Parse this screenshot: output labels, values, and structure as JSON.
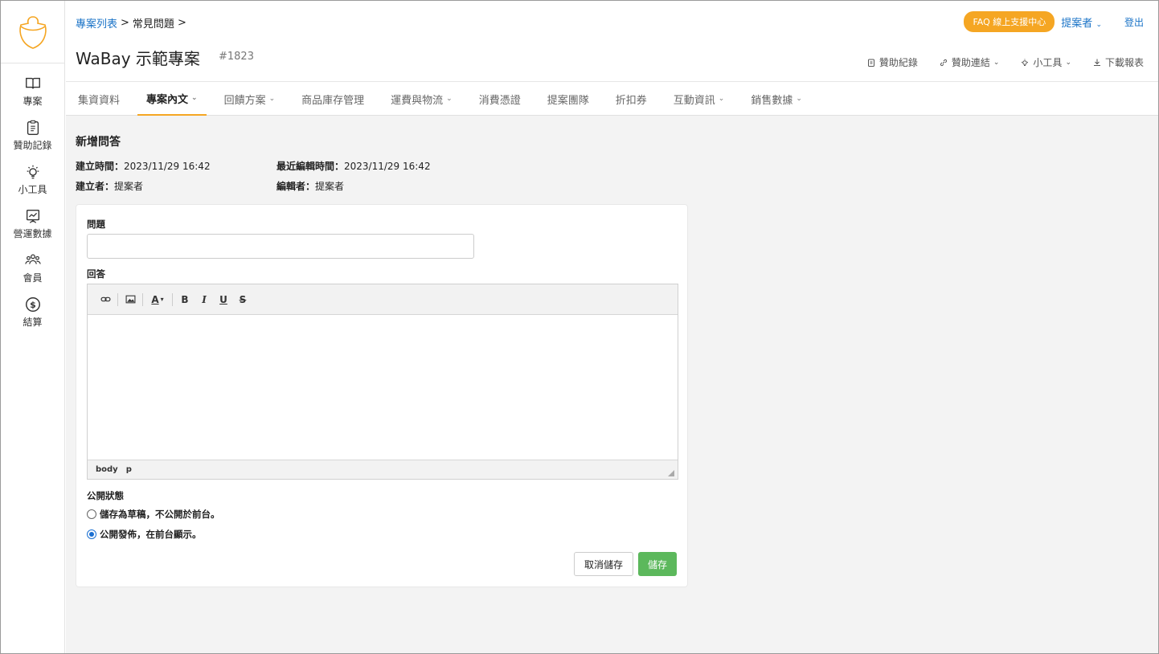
{
  "sidebar": {
    "items": [
      {
        "label": "專案",
        "icon": "book-icon"
      },
      {
        "label": "贊助記錄",
        "icon": "clipboard-icon"
      },
      {
        "label": "小工具",
        "icon": "lightbulb-icon"
      },
      {
        "label": "營運數據",
        "icon": "chart-board-icon"
      },
      {
        "label": "會員",
        "icon": "users-icon"
      },
      {
        "label": "結算",
        "icon": "dollar-circle-icon"
      }
    ]
  },
  "header": {
    "breadcrumb": {
      "root": "專案列表",
      "current": "常見問題",
      "sep": ">"
    },
    "title": "WaBay 示範專案",
    "project_id": "#1823",
    "faq_button": "FAQ 線上支援中心",
    "user_menu": "提案者",
    "logout": "登出",
    "tools": [
      {
        "label": "贊助紀錄",
        "icon": "clipboard-icon"
      },
      {
        "label": "贊助連結",
        "icon": "link-icon"
      },
      {
        "label": "小工具",
        "icon": "lightbulb-icon"
      },
      {
        "label": "下載報表",
        "icon": "download-icon"
      }
    ]
  },
  "tabs": [
    {
      "label": "集資資料"
    },
    {
      "label": "專案內文",
      "active": true
    },
    {
      "label": "回饋方案"
    },
    {
      "label": "商品庫存管理"
    },
    {
      "label": "運費與物流"
    },
    {
      "label": "消費憑證"
    },
    {
      "label": "提案團隊"
    },
    {
      "label": "折扣券"
    },
    {
      "label": "互動資訊"
    },
    {
      "label": "銷售數據"
    }
  ],
  "form": {
    "section_title": "新增問答",
    "created_label": "建立時間：",
    "created_value": "2023/11/29 16:42",
    "edited_label": "最近編輯時間：",
    "edited_value": "2023/11/29 16:42",
    "creator_label": "建立者：",
    "creator_value": "提案者",
    "editor_label": "編輯者：",
    "editor_value": "提案者",
    "question_label": "問題",
    "question_value": "",
    "answer_label": "回答",
    "editor_status_body": "body",
    "editor_status_p": "p",
    "visibility_label": "公開狀態",
    "option_draft": "儲存為草稿，不公開於前台。",
    "option_publish": "公開發佈，在前台顯示。",
    "selected_option": "publish",
    "cancel_button": "取消儲存",
    "save_button": "儲存"
  },
  "colors": {
    "accent": "#f5a623",
    "link": "#1a73c7",
    "save": "#5cb85c"
  }
}
